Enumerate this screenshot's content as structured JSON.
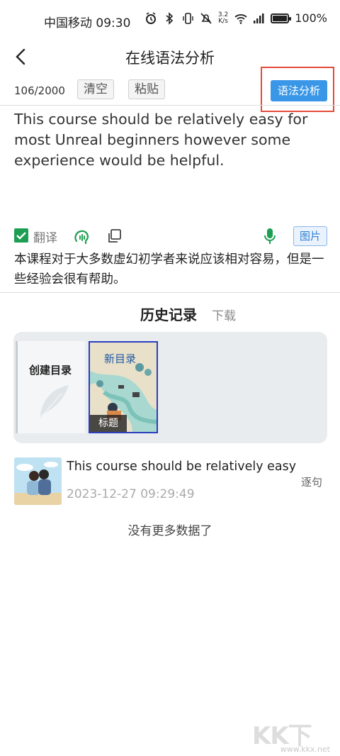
{
  "status_bar": {
    "carrier_time": "中国移动 09:30",
    "net_speed_value": "3.2",
    "net_speed_unit": "K/s",
    "battery": "100%",
    "battery_level": 1.0,
    "icons": [
      "alarm-icon",
      "bluetooth-icon",
      "vibrate-icon",
      "mute-icon",
      "wifi-icon",
      "signal-icon",
      "battery-icon"
    ]
  },
  "nav": {
    "title": "在线语法分析"
  },
  "toolbar": {
    "counter": "106/2000",
    "clear_label": "清空",
    "paste_label": "粘贴",
    "analyze_label": "语法分析"
  },
  "input": {
    "text": "This course should be relatively easy for most Unreal beginners however some experience would be helpful."
  },
  "actions": {
    "translate_label": "翻译",
    "translate_checked": true,
    "image_label": "图片"
  },
  "translation": {
    "text": "本课程对于大多数虚幻初学者来说应该相对容易，但是一些经验会很有帮助。"
  },
  "history": {
    "title": "历史记录",
    "download_label": "下载",
    "cards": [
      {
        "title": "创建目录"
      },
      {
        "title": "新目录",
        "label": "标题"
      }
    ],
    "records": [
      {
        "text": "This course should be relatively easy fo",
        "time": "2023-12-27 09:29:49",
        "action": "逐句"
      }
    ],
    "empty_text": "没有更多数据了"
  },
  "watermark": {
    "main": "KK下载",
    "url": "www.kkx.net"
  },
  "colors": {
    "accent": "#3a97e8",
    "highlight": "#e5493a",
    "check": "#1e9e52",
    "panel": "#e8ecef"
  }
}
